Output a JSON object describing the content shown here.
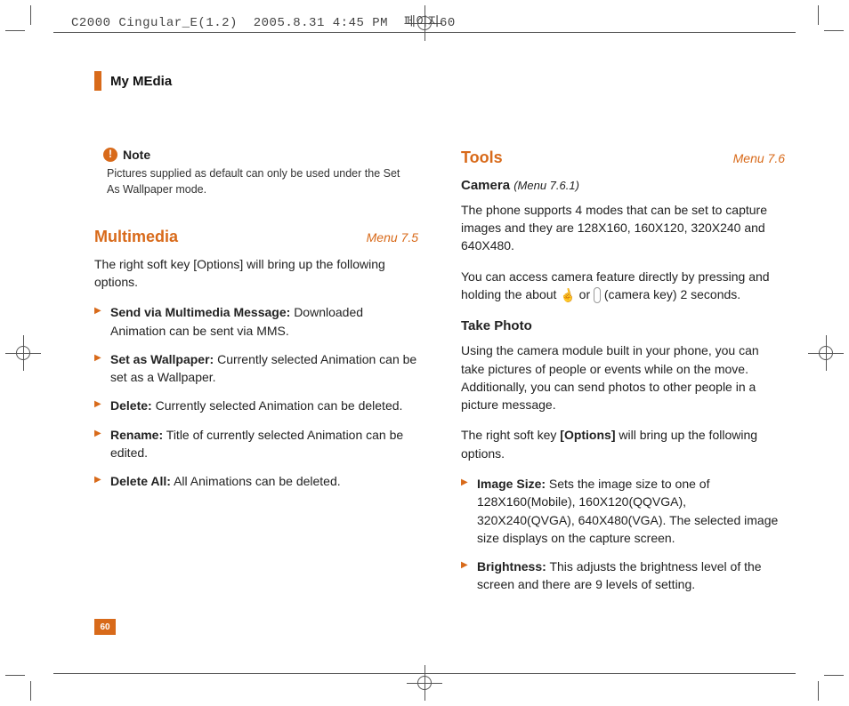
{
  "slug": {
    "doc": "C2000 Cingular_E(1.2)",
    "date": "2005.8.31 4:45 PM",
    "page": "페이지60"
  },
  "section_title": "My MEdia",
  "page_number": "60",
  "left": {
    "note": {
      "label": "Note",
      "body": "Pictures supplied as default can only be used under the Set As Wallpaper mode."
    },
    "multimedia": {
      "title": "Multimedia",
      "menu_ref": "Menu 7.5",
      "intro": "The right soft key [Options] will bring up the following options.",
      "options": [
        {
          "label": "Send via Multimedia Message:",
          "desc": "Downloaded Animation can be sent via MMS."
        },
        {
          "label": "Set as Wallpaper:",
          "desc": "Currently selected Animation can be set as a Wallpaper."
        },
        {
          "label": "Delete:",
          "desc": "Currently selected Animation can be deleted."
        },
        {
          "label": "Rename:",
          "desc": "Title of currently selected Animation can be edited."
        },
        {
          "label": "Delete All:",
          "desc": "All Animations can be deleted."
        }
      ]
    }
  },
  "right": {
    "tools": {
      "title": "Tools",
      "menu_ref": "Menu 7.6",
      "camera": {
        "title": "Camera",
        "menu_ref": "(Menu 7.6.1)",
        "modes_para": "The phone supports 4 modes that can be set to capture images and they are 128X160, 160X120, 320X240 and 640X480.",
        "access_para_1": "You can access camera feature directly by pressing and holding the about ",
        "access_or": " or ",
        "access_para_2": " (camera key) 2 seconds."
      },
      "take_photo": {
        "title": "Take Photo",
        "para": "Using the camera module built in your phone, you can take pictures of people or events while on the move. Additionally, you can send photos to other people in a picture message.",
        "softkey_1": "The right soft key ",
        "softkey_bold": "[Options]",
        "softkey_2": " will bring up the following options.",
        "options": [
          {
            "label": "Image Size:",
            "desc": "Sets the image size to one of 128X160(Mobile), 160X120(QQVGA), 320X240(QVGA), 640X480(VGA). The selected image size displays on the capture screen."
          },
          {
            "label": "Brightness:",
            "desc": "This adjusts the brightness level of the screen and there are 9 levels of setting."
          }
        ]
      }
    }
  }
}
